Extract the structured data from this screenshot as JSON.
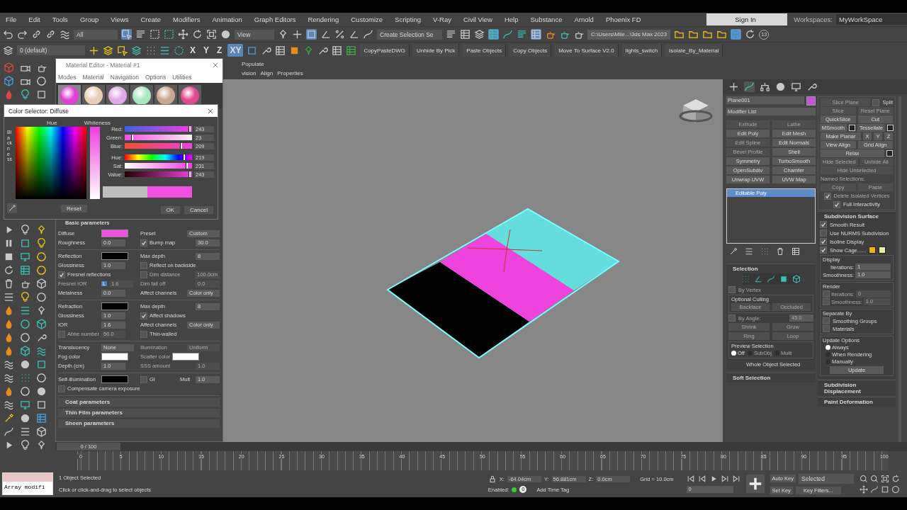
{
  "menu": [
    "File",
    "Edit",
    "Tools",
    "Group",
    "Views",
    "Create",
    "Modifiers",
    "Animation",
    "Graph Editors",
    "Rendering",
    "Customize",
    "Scripting",
    "V-Ray",
    "Civil View",
    "Help",
    "Substance",
    "Arnold",
    "Phoenix FD"
  ],
  "account": {
    "sign_in": "Sign In",
    "workspaces_label": "Workspaces:",
    "workspace": "MyWorkSpace"
  },
  "main_toolbar": {
    "selection_filter": "All",
    "reference_coord": "View",
    "selection_set": "Create Selection Se",
    "project_path": "C:\\Users\\Mile...\\3ds Max 2023",
    "autosave_count": "13"
  },
  "secondary_toolbar": {
    "layer": "0 (default)",
    "axis_constraints": [
      {
        "label": "X",
        "selected": false
      },
      {
        "label": "Y",
        "selected": false
      },
      {
        "label": "Z",
        "selected": false
      },
      {
        "label": "XY",
        "selected": true
      }
    ],
    "scripts": [
      "CopyPasteDWG",
      "Unhide By Pick",
      "Paste Objects",
      "Copy Objects",
      "Move To Surface V2.0",
      "lights_switch",
      "Isolate_By_Material"
    ]
  },
  "ribbon": {
    "tab": "Populate",
    "items": [
      "vision",
      "Align",
      "Properties"
    ]
  },
  "material_editor": {
    "title": "Material Editor - Material #1",
    "menu": [
      "Modes",
      "Material",
      "Navigation",
      "Options",
      "Utilities"
    ],
    "sample_slots": [
      {
        "color": "#e040d8",
        "selected": true
      },
      {
        "color": "#e8cfb4",
        "selected": false
      },
      {
        "color": "#e0a8e8",
        "selected": false
      },
      {
        "color": "#a8e8c0",
        "selected": false
      },
      {
        "color": "#c8a890",
        "selected": false
      },
      {
        "color": "#e04890",
        "selected": false
      }
    ],
    "section": "Basic parameters",
    "groups": [
      [
        {
          "cells": [
            {
              "kind": "swatch",
              "label": "Diffuse",
              "color": "#f050e0",
              "disabled": false
            },
            {
              "kind": "dropdown",
              "label": "Preset",
              "value": "Custom",
              "disabled": false
            }
          ]
        },
        {
          "cells": [
            {
              "kind": "spinner",
              "label": "Roughness",
              "value": "0.0",
              "disabled": false
            },
            {
              "kind": "check",
              "label": "Bump map",
              "checked": true,
              "value": "30.0",
              "disabled": false
            }
          ]
        }
      ],
      [
        {
          "cells": [
            {
              "kind": "swatch",
              "label": "Reflection",
              "color": "#000000",
              "disabled": false
            },
            {
              "kind": "spinner",
              "label": "Max depth",
              "value": "8",
              "disabled": false
            }
          ]
        },
        {
          "cells": [
            {
              "kind": "spinner",
              "label": "Glossiness",
              "value": "1.0",
              "disabled": false
            },
            {
              "kind": "check",
              "label": "Reflect on backside",
              "checked": false,
              "disabled": false
            }
          ]
        },
        {
          "cells": [
            {
              "kind": "check",
              "label": "Fresnel reflections",
              "checked": true,
              "disabled": false
            },
            {
              "kind": "check",
              "label": "Dim distance",
              "checked": false,
              "value": "100.0cm",
              "disabled": true
            }
          ]
        },
        {
          "cells": [
            {
              "kind": "spinner",
              "label": "Fresnel IOR",
              "badge": "L",
              "value": "1.6",
              "disabled": true
            },
            {
              "kind": "spinner",
              "label": "Dim fall off",
              "value": "0.0",
              "disabled": true
            }
          ]
        },
        {
          "cells": [
            {
              "kind": "spinner",
              "label": "Metalness",
              "value": "0.0",
              "disabled": false
            },
            {
              "kind": "dropdown",
              "label": "Affect channels",
              "value": "Color only",
              "disabled": false
            }
          ]
        }
      ],
      [
        {
          "cells": [
            {
              "kind": "swatch",
              "label": "Refraction",
              "color": "#000000",
              "disabled": false
            },
            {
              "kind": "spinner",
              "label": "Max depth",
              "value": "8",
              "disabled": false
            }
          ]
        },
        {
          "cells": [
            {
              "kind": "spinner",
              "label": "Glossiness",
              "value": "1.0",
              "disabled": false
            },
            {
              "kind": "check",
              "label": "Affect shadows",
              "checked": true,
              "disabled": false
            }
          ]
        },
        {
          "cells": [
            {
              "kind": "spinner",
              "label": "IOR",
              "value": "1.6",
              "disabled": false
            },
            {
              "kind": "dropdown",
              "label": "Affect channels",
              "value": "Color only",
              "disabled": false
            }
          ]
        },
        {
          "cells": [
            {
              "kind": "check",
              "label": "Abbe number",
              "checked": false,
              "value": "50.0",
              "disabled": true
            },
            {
              "kind": "check",
              "label": "Thin-walled",
              "checked": false,
              "disabled": false
            }
          ]
        }
      ],
      [
        {
          "cells": [
            {
              "kind": "dropdown",
              "label": "Translucency",
              "value": "None",
              "disabled": false
            },
            {
              "kind": "dropdown",
              "label": "Illumination",
              "value": "Uniform",
              "disabled": true
            }
          ]
        },
        {
          "cells": [
            {
              "kind": "swatch",
              "label": "Fog color",
              "color": "#ffffff",
              "disabled": false
            },
            {
              "kind": "swatch",
              "label": "Scatter color",
              "color": "#ffffff",
              "disabled": true
            }
          ]
        },
        {
          "cells": [
            {
              "kind": "spinner",
              "label": "Depth (cm)",
              "value": "1.0",
              "disabled": false
            },
            {
              "kind": "spinner",
              "label": "SSS amount",
              "value": "1.0",
              "disabled": true
            }
          ]
        }
      ],
      [
        {
          "cells": [
            {
              "kind": "swatch",
              "label": "Self-illumination",
              "color": "#000000",
              "disabled": false
            },
            {
              "kind": "check",
              "label": "GI",
              "checked": false,
              "disabled": false
            },
            {
              "kind": "spinner",
              "label": "Mult",
              "value": "1.0",
              "disabled": false
            }
          ]
        },
        {
          "cells": [
            {
              "kind": "check",
              "label": "Compensate camera exposure",
              "checked": false,
              "disabled": false
            }
          ]
        }
      ]
    ],
    "rollouts": [
      "Coat parameters",
      "Thin Film parameters",
      "Sheen parameters"
    ]
  },
  "color_selector": {
    "title": "Color Selector: Diffuse",
    "hue_label": "Hue",
    "whiteness_label": "Whiteness",
    "blackness_label": "Blackness",
    "channels": [
      {
        "label": "Red:",
        "value": "243",
        "level": 0.95
      },
      {
        "label": "Green:",
        "value": "23",
        "level": 0.09
      },
      {
        "label": "Blue:",
        "value": "209",
        "level": 0.82
      },
      {
        "label": "Hue:",
        "value": "219",
        "level": 0.86
      },
      {
        "label": "Sat:",
        "value": "231",
        "level": 0.9
      },
      {
        "label": "Value:",
        "value": "243",
        "level": 0.95
      }
    ],
    "reset": "Reset",
    "ok": "OK",
    "cancel": "Cancel"
  },
  "command_panel": {
    "object_name": "Plane001",
    "modifier_list": "Modifier List",
    "modifier_buttons": [
      {
        "label": "Extrude",
        "disabled": true
      },
      {
        "label": "Lathe",
        "disabled": true
      },
      {
        "label": "Edit Poly",
        "disabled": false
      },
      {
        "label": "Edit Mesh",
        "disabled": false
      },
      {
        "label": "Edit Spline",
        "disabled": true
      },
      {
        "label": "Edit Normals",
        "disabled": false
      },
      {
        "label": "Bevel Profile",
        "disabled": true
      },
      {
        "label": "Shell",
        "disabled": false
      },
      {
        "label": "Symmetry",
        "disabled": false
      },
      {
        "label": "TurboSmooth",
        "disabled": false
      },
      {
        "label": "OpenSubdiv",
        "disabled": false
      },
      {
        "label": "Chamfer",
        "disabled": false
      },
      {
        "label": "Unwrap UVW",
        "disabled": false
      },
      {
        "label": "UVW Map",
        "disabled": false
      }
    ],
    "stack": [
      {
        "label": "Editable Poly",
        "selected": true
      }
    ],
    "selection": {
      "title": "Selection",
      "by_vertex": {
        "label": "By Vertex",
        "checked": false
      },
      "culling_label": "Optional Culling",
      "culling_buttons": [
        "Backface",
        "Occluded"
      ],
      "by_angle": {
        "label": "By Angle:",
        "value": "45.0",
        "checked": false
      },
      "grow_buttons": [
        "Shrink",
        "Grow"
      ],
      "loop_buttons": [
        "Ring",
        "Loop"
      ],
      "preview_label": "Preview Selection",
      "preview_options": [
        {
          "label": "Off",
          "selected": true
        },
        {
          "label": "SubObj",
          "selected": false
        },
        {
          "label": "Multi",
          "selected": false
        }
      ],
      "status": "Whole Object Selected"
    },
    "soft_selection": "Soft Selection",
    "edit_rows": [
      [
        {
          "kind": "button",
          "label": "Slice Plane",
          "disabled": true
        },
        {
          "kind": "check",
          "label": "Split",
          "checked": false,
          "disabled": false
        }
      ],
      [
        {
          "kind": "button",
          "label": "Slice",
          "disabled": true
        },
        {
          "kind": "button",
          "label": "Reset Plane",
          "disabled": true
        }
      ],
      [
        {
          "kind": "button",
          "label": "QuickSlice",
          "disabled": false
        },
        {
          "kind": "button",
          "label": "Cut",
          "disabled": false
        }
      ],
      [
        {
          "kind": "settings-button",
          "label": "MSmooth",
          "disabled": false
        },
        {
          "kind": "settings-button",
          "label": "Tessellate",
          "disabled": false
        }
      ],
      [
        {
          "kind": "button",
          "label": "Make Planar",
          "disabled": false
        },
        {
          "kind": "small-button",
          "label": "X",
          "disabled": false
        },
        {
          "kind": "small-button",
          "label": "Y",
          "disabled": false
        },
        {
          "kind": "small-button",
          "label": "Z",
          "disabled": false
        }
      ],
      [
        {
          "kind": "button",
          "label": "View Align",
          "disabled": false
        },
        {
          "kind": "button",
          "label": "Grid Align",
          "disabled": false
        }
      ],
      [
        {
          "kind": "settings-button",
          "label": "Relax",
          "disabled": false
        }
      ],
      [
        {
          "kind": "button",
          "label": "Hide Selected",
          "disabled": true
        },
        {
          "kind": "button",
          "label": "Unhide All",
          "disabled": true
        }
      ],
      [
        {
          "kind": "button",
          "label": "Hide Unselected",
          "disabled": true
        }
      ],
      [
        {
          "kind": "label",
          "label": "Named Selections:",
          "disabled": true
        }
      ],
      [
        {
          "kind": "button",
          "label": "Copy",
          "disabled": true
        },
        {
          "kind": "button",
          "label": "Paste",
          "disabled": true
        }
      ],
      [
        {
          "kind": "check",
          "label": "Delete Isolated Vertices",
          "checked": true,
          "disabled": true
        }
      ],
      [
        {
          "kind": "check",
          "label": "Full Interactivity",
          "checked": true,
          "disabled": false
        }
      ]
    ],
    "subdivision": {
      "title": "Subdivision Surface",
      "checks": [
        {
          "label": "Smooth Result",
          "checked": true
        },
        {
          "label": "Use NURMS Subdivision",
          "checked": false
        },
        {
          "label": "Isoline Display",
          "checked": true
        },
        {
          "label": "Show Cage......",
          "checked": true
        }
      ],
      "cage_colors": [
        {
          "color": "#f2b600"
        },
        {
          "color": "#e2f0a0"
        }
      ],
      "display": {
        "title": "Display",
        "fields": [
          {
            "label": "Iterations:",
            "value": "1"
          },
          {
            "label": "Smoothness:",
            "value": "1.0"
          }
        ]
      },
      "render": {
        "title": "Render",
        "fields": [
          {
            "label": "Iterations:",
            "value": "0",
            "checked": false
          },
          {
            "label": "Smoothness:",
            "value": "1.0",
            "checked": false
          }
        ]
      },
      "separate_by": {
        "title": "Separate By",
        "options": [
          {
            "label": "Smoothing Groups",
            "checked": false
          },
          {
            "label": "Materials",
            "checked": false
          }
        ]
      },
      "update": {
        "title": "Update Options",
        "options": [
          {
            "label": "Always",
            "selected": true
          },
          {
            "label": "When Rendering",
            "selected": false
          },
          {
            "label": "Manually",
            "selected": false
          }
        ],
        "button": "Update"
      }
    },
    "rollouts": [
      "Subdivision Displacement",
      "Paint Deformation"
    ]
  },
  "time_slider": "0 / 100",
  "timeline_ticks": [
    "0",
    "5",
    "10",
    "15",
    "20",
    "25",
    "30",
    "35",
    "40",
    "45",
    "50",
    "55",
    "60",
    "65",
    "70",
    "75",
    "80",
    "85",
    "90",
    "95",
    "100"
  ],
  "status": {
    "listener": "Array modifi",
    "selection": "1 Object Selected",
    "prompt": "Click or click-and-drag to select objects",
    "coords": [
      {
        "label": "X:",
        "value": "-64.04cm"
      },
      {
        "label": "Y:",
        "value": "56.881cm"
      },
      {
        "label": "Z:",
        "value": "0.0cm"
      }
    ],
    "grid": "Grid = 10.0cm",
    "enabled_label": "Enabled:",
    "time_tag_count": "0",
    "add_time_tag": "Add Time Tag",
    "auto_key": "Auto Key",
    "key_mode": "Selected",
    "set_key": "Set Key",
    "key_filters": "Key Filters...",
    "frame": "0"
  }
}
